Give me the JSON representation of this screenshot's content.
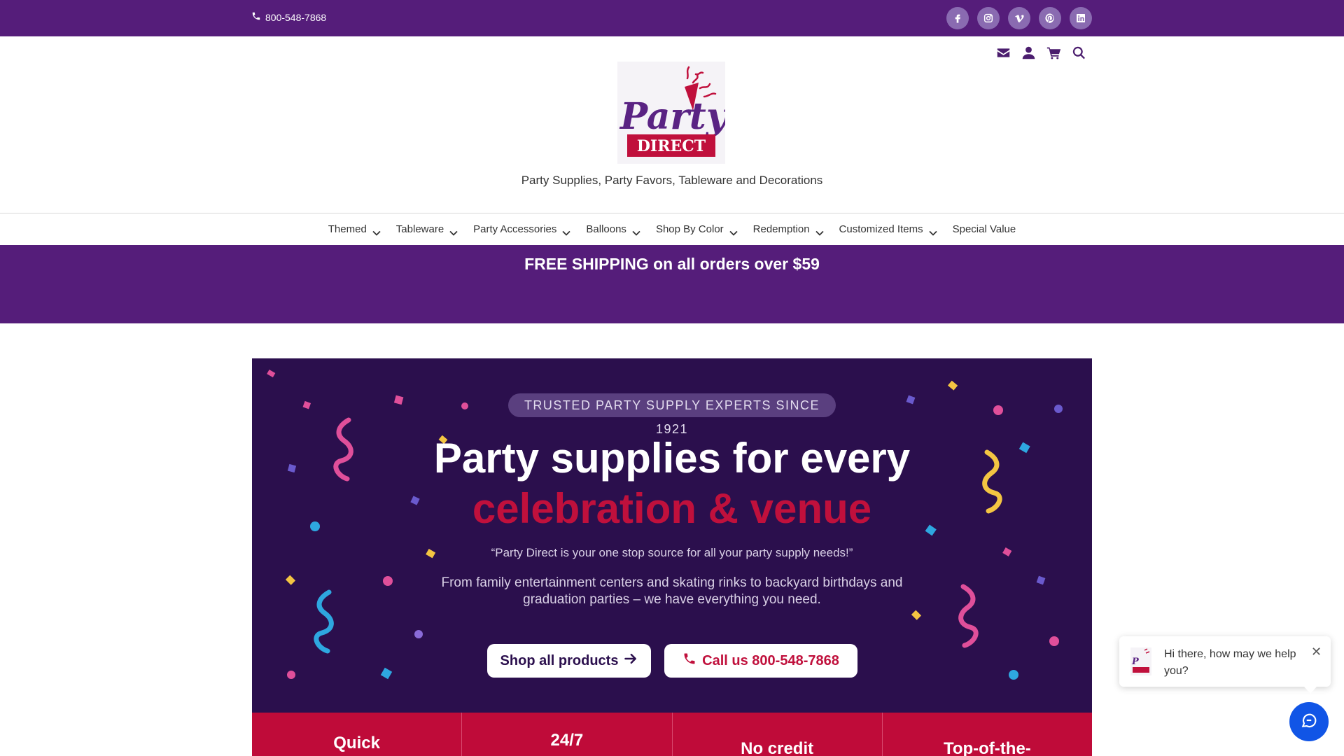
{
  "topbar": {
    "phone": "800-548-7868",
    "socials": [
      {
        "icon": "facebook-icon"
      },
      {
        "icon": "instagram-icon"
      },
      {
        "icon": "vimeo-icon"
      },
      {
        "icon": "pinterest-icon"
      },
      {
        "icon": "linkedin-icon"
      }
    ]
  },
  "header": {
    "utility_icons": [
      "envelope-icon",
      "user-icon",
      "cart-icon",
      "search-icon"
    ],
    "logo": {
      "top": "Party",
      "bottom": "DIRECT"
    },
    "tagline": "Party Supplies, Party Favors, Tableware and Decorations"
  },
  "nav": {
    "items": [
      {
        "label": "Themed",
        "dropdown": true
      },
      {
        "label": "Tableware",
        "dropdown": true
      },
      {
        "label": "Party Accessories",
        "dropdown": true
      },
      {
        "label": "Balloons",
        "dropdown": true
      },
      {
        "label": "Shop By Color",
        "dropdown": true
      },
      {
        "label": "Redemption",
        "dropdown": true
      },
      {
        "label": "Customized Items",
        "dropdown": true
      },
      {
        "label": "Special Value",
        "dropdown": false
      }
    ]
  },
  "promo": {
    "text": "FREE SHIPPING on all orders over $59"
  },
  "hero": {
    "badge": "TRUSTED PARTY SUPPLY EXPERTS SINCE 1921",
    "headline_line1": "Party supplies for every",
    "headline_line2": "celebration & venue",
    "quote": "“Party Direct is your one stop source for all your party supply needs!”",
    "description": "From family entertainment centers and skating rinks to backyard birthdays and graduation parties – we have everything you need.",
    "shop_button": "Shop all products",
    "call_button": "Call us 800-548-7868"
  },
  "features": [
    "Quick",
    "24/7",
    "No credit",
    "Top-of-the-"
  ],
  "chat": {
    "message": "Hi there, how may we help you?",
    "close": "✕"
  },
  "colors": {
    "brand_purple": "#551d7a",
    "hero_bg": "#2b0f4d",
    "accent_red": "#c0103c",
    "chat_blue": "#1155e6"
  }
}
